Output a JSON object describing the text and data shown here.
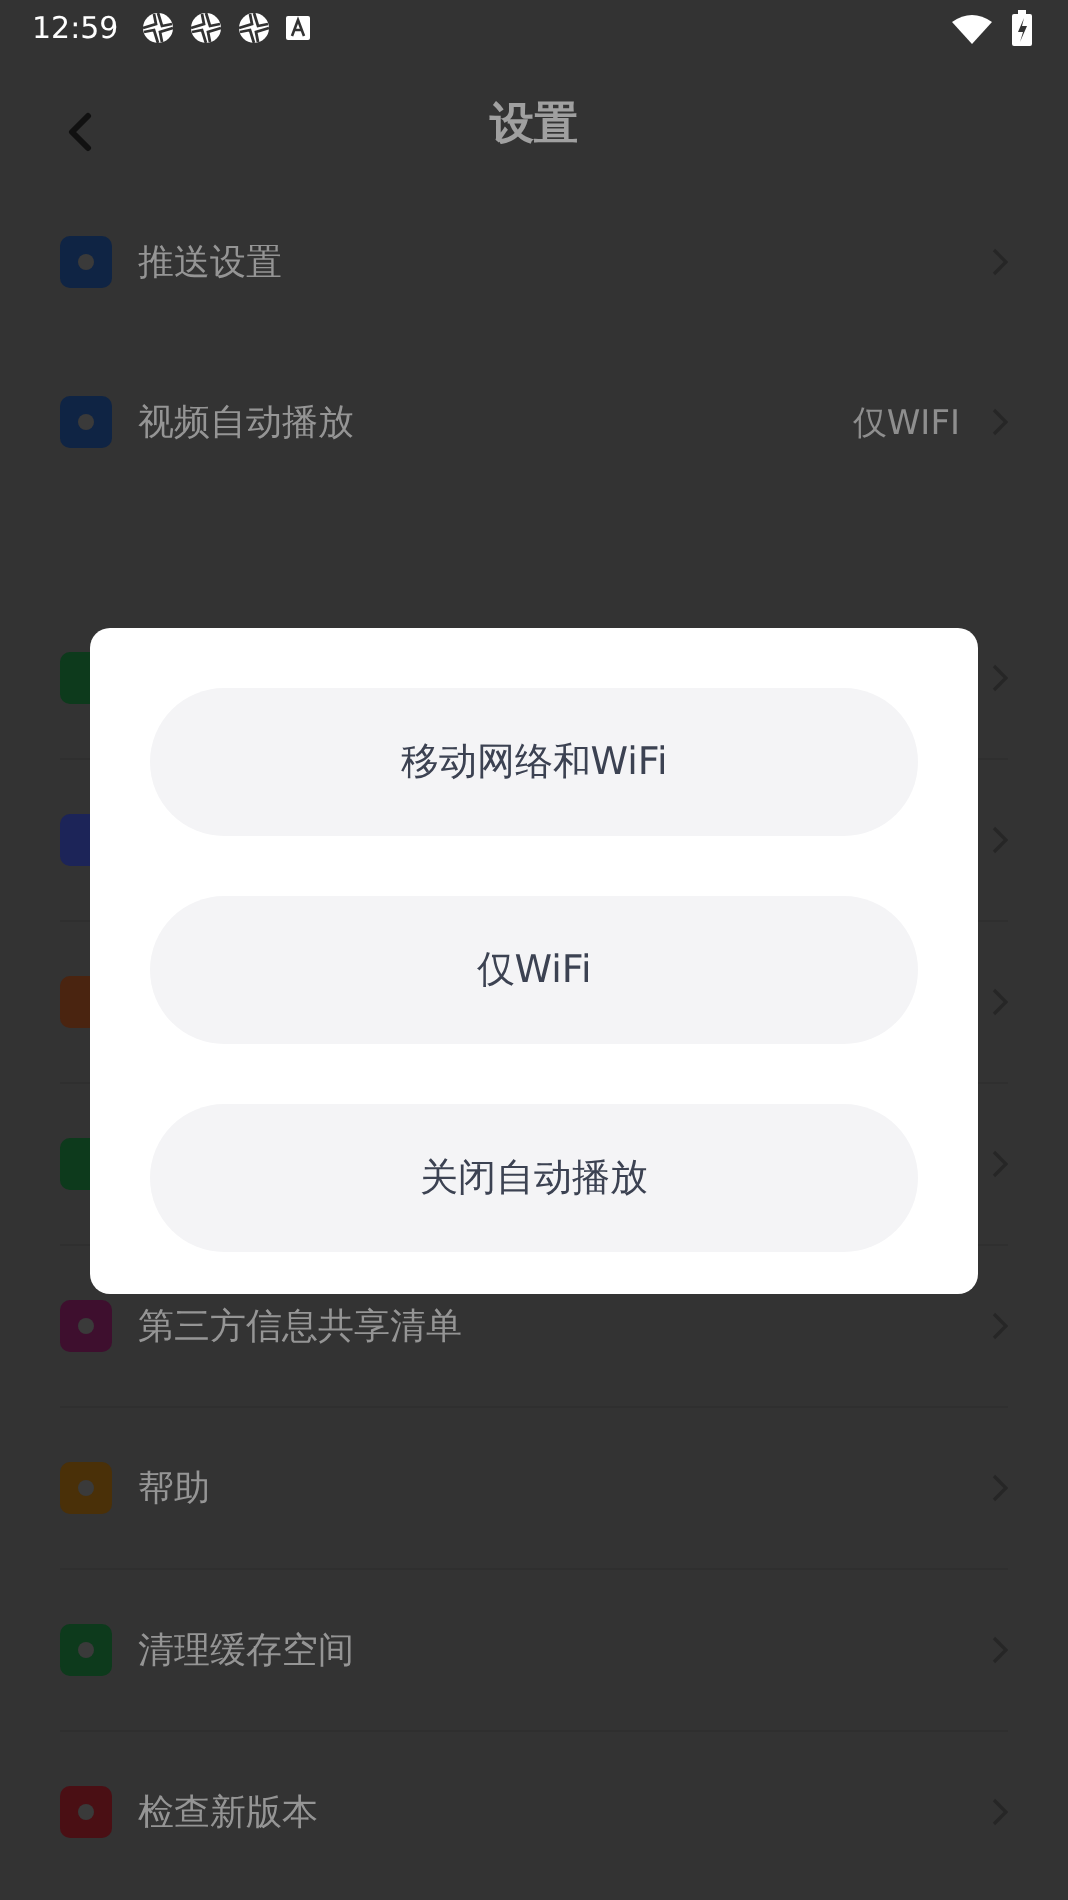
{
  "status_bar": {
    "time": "12:59"
  },
  "header": {
    "title": "设置"
  },
  "groups": [
    {
      "rows": [
        {
          "label": "推送设置",
          "color": "#0f2444"
        },
        {
          "label": "视频自动播放",
          "value": "仅WIFI",
          "color": "#0f2444"
        }
      ]
    },
    {
      "rows": [
        {
          "color": "#0d3a1c"
        },
        {
          "color": "#1c2458"
        },
        {
          "color": "#4a2410"
        },
        {
          "color": "#0d3a1c"
        },
        {
          "label": "第三方信息共享清单",
          "color": "#3e0f2e"
        },
        {
          "label": "帮助",
          "color": "#4a3008"
        },
        {
          "label": "清理缓存空间",
          "color": "#0d3a1c"
        },
        {
          "label": "检查新版本",
          "color": "#4a0f14"
        }
      ]
    }
  ],
  "dialog": {
    "options": [
      {
        "label": "移动网络和WiFi"
      },
      {
        "label": "仅WiFi"
      },
      {
        "label": "关闭自动播放"
      }
    ]
  }
}
